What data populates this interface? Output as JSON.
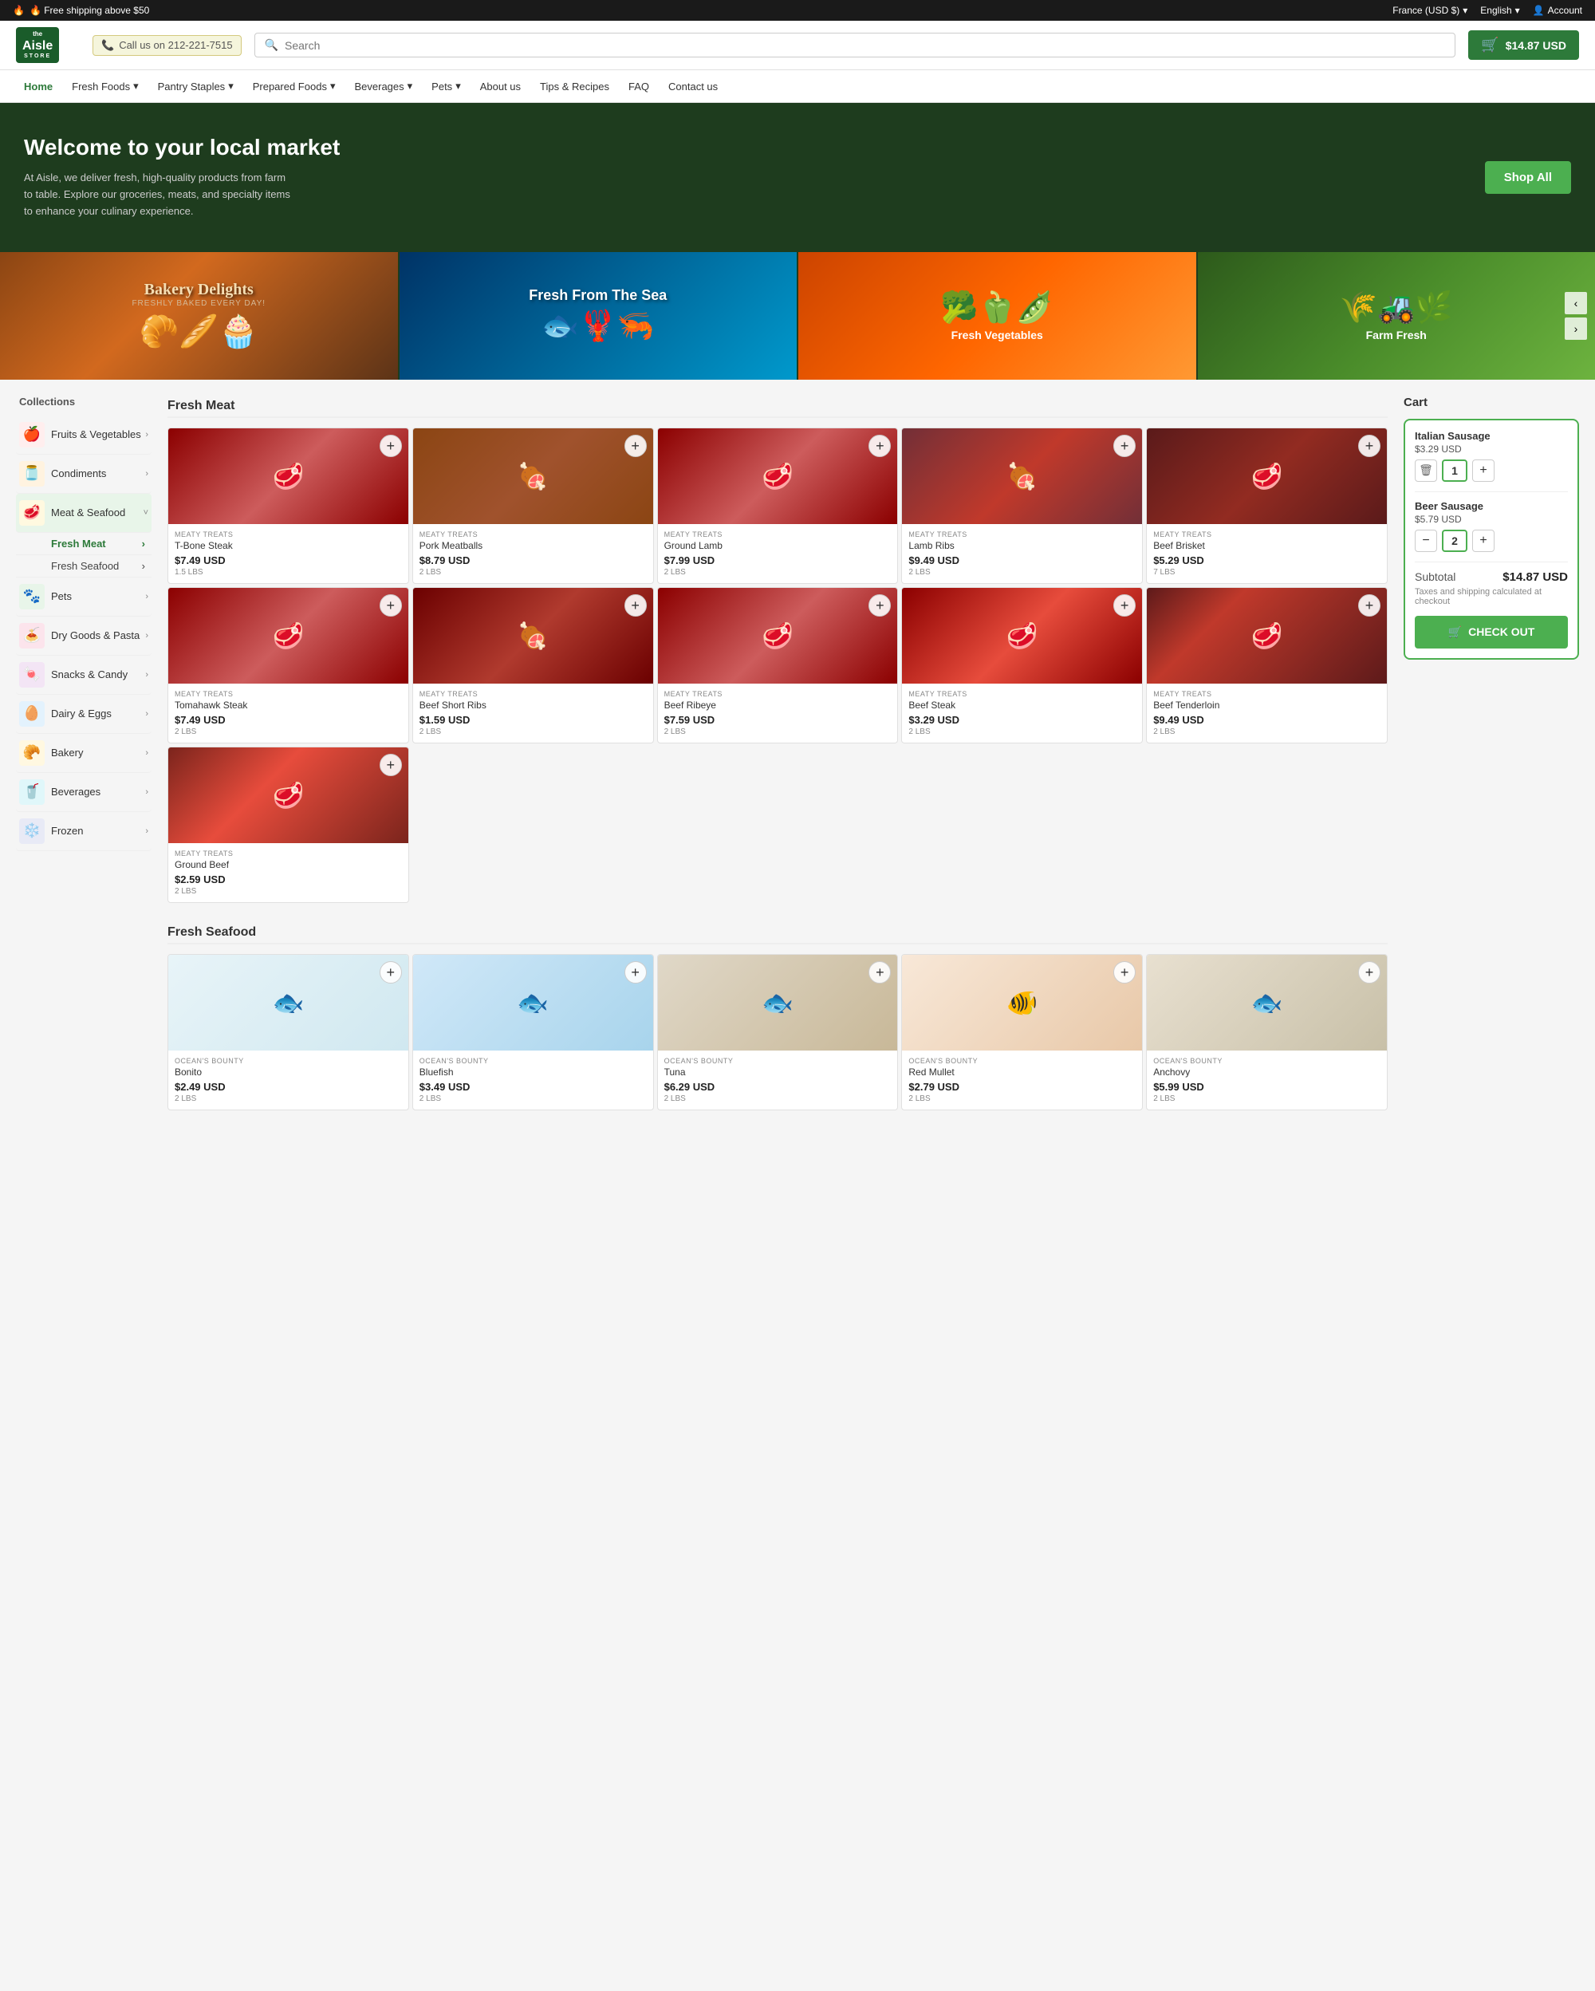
{
  "announcement": {
    "text": "🔥 Free shipping above $50",
    "currency": "France (USD $)",
    "language": "English",
    "account": "Account"
  },
  "header": {
    "logo_line1": "the",
    "logo_line2": "Aisle",
    "logo_line3": "STORE",
    "phone_label": "Call us on 212-221-7515",
    "search_placeholder": "Search",
    "cart_total": "$14.87 USD"
  },
  "nav": {
    "items": [
      {
        "label": "Home",
        "active": true
      },
      {
        "label": "Fresh Foods",
        "has_dropdown": true
      },
      {
        "label": "Pantry Staples",
        "has_dropdown": true
      },
      {
        "label": "Prepared Foods",
        "has_dropdown": true
      },
      {
        "label": "Beverages",
        "has_dropdown": true
      },
      {
        "label": "Pets",
        "has_dropdown": true
      },
      {
        "label": "About us"
      },
      {
        "label": "Tips & Recipes"
      },
      {
        "label": "FAQ"
      },
      {
        "label": "Contact us"
      }
    ]
  },
  "hero": {
    "title": "Welcome to your local market",
    "description": "At Aisle, we deliver fresh, high-quality products from farm to table. Explore our groceries, meats, and specialty items to enhance your culinary experience.",
    "shop_all_label": "Shop All"
  },
  "banners": [
    {
      "label": "Bakery Delights",
      "subtitle": "FRESHLY BAKED EVERY DAY!",
      "type": "bakery"
    },
    {
      "label": "Fresh From The Sea",
      "type": "sea"
    },
    {
      "label": "Fresh Vegetables",
      "type": "veggies"
    },
    {
      "label": "Farm Fresh",
      "type": "farm"
    }
  ],
  "sidebar": {
    "collections_label": "Collections",
    "categories": [
      {
        "icon": "🍎",
        "label": "Fruits & Vegetables",
        "bg": "#ffeeee"
      },
      {
        "icon": "🫙",
        "label": "Condiments",
        "bg": "#fff3e0"
      },
      {
        "icon": "🥩",
        "label": "Meat & Seafood",
        "bg": "#fff9e0",
        "active": true
      },
      {
        "icon": "🐾",
        "label": "Pets",
        "bg": "#e8f5e9"
      },
      {
        "icon": "🍝",
        "label": "Dry Goods & Pasta",
        "bg": "#fce4ec"
      },
      {
        "icon": "🍬",
        "label": "Snacks & Candy",
        "bg": "#f3e5f5"
      },
      {
        "icon": "🥚",
        "label": "Dairy & Eggs",
        "bg": "#e3f2fd"
      },
      {
        "icon": "🥐",
        "label": "Bakery",
        "bg": "#fff8e1"
      },
      {
        "icon": "🥤",
        "label": "Beverages",
        "bg": "#e0f7fa"
      },
      {
        "icon": "❄️",
        "label": "Frozen",
        "bg": "#e8eaf6"
      }
    ],
    "subcategories": [
      {
        "label": "Fresh Meat",
        "active": true
      },
      {
        "label": "Fresh Seafood"
      }
    ]
  },
  "fresh_meat": {
    "section_label": "Fresh Meat",
    "products": [
      {
        "brand": "Meaty Treats",
        "name": "T-Bone Steak",
        "price": "$7.49 USD",
        "weight": "1.5 LBS",
        "emoji": "🥩"
      },
      {
        "brand": "Meaty Treats",
        "name": "Pork Meatballs",
        "price": "$8.79 USD",
        "weight": "2 LBS",
        "emoji": "🍖"
      },
      {
        "brand": "Meaty Treats",
        "name": "Ground Lamb",
        "price": "$7.99 USD",
        "weight": "2 LBS",
        "emoji": "🥩"
      },
      {
        "brand": "Meaty Treats",
        "name": "Lamb Ribs",
        "price": "$9.49 USD",
        "weight": "2 LBS",
        "emoji": "🍖"
      },
      {
        "brand": "Meaty Treats",
        "name": "Beef Brisket",
        "price": "$5.29 USD",
        "weight": "7 LBS",
        "emoji": "🥩"
      },
      {
        "brand": "Meaty Treats",
        "name": "Tomahawk Steak",
        "price": "$7.49 USD",
        "weight": "2 LBS",
        "emoji": "🥩"
      },
      {
        "brand": "Meaty Treats",
        "name": "Beef Short Ribs",
        "price": "$1.59 USD",
        "weight": "2 LBS",
        "emoji": "🍖"
      },
      {
        "brand": "Meaty Treats",
        "name": "Beef Ribeye",
        "price": "$7.59 USD",
        "weight": "2 LBS",
        "emoji": "🥩"
      },
      {
        "brand": "Meaty Treats",
        "name": "Beef Steak",
        "price": "$3.29 USD",
        "weight": "2 LBS",
        "emoji": "🥩"
      },
      {
        "brand": "Meaty Treats",
        "name": "Beef Tenderloin",
        "price": "$9.49 USD",
        "weight": "2 LBS",
        "emoji": "🥩"
      },
      {
        "brand": "Meaty Treats",
        "name": "Ground Beef",
        "price": "$2.59 USD",
        "weight": "2 LBS",
        "emoji": "🥩"
      }
    ]
  },
  "fresh_seafood": {
    "section_label": "Fresh Seafood",
    "products": [
      {
        "brand": "Ocean's Bounty",
        "name": "Bonito",
        "price": "$2.49 USD",
        "weight": "2 LBS",
        "emoji": "🐟"
      },
      {
        "brand": "Ocean's Bounty",
        "name": "Bluefish",
        "price": "$3.49 USD",
        "weight": "2 LBS",
        "emoji": "🐟"
      },
      {
        "brand": "Ocean's Bounty",
        "name": "Tuna",
        "price": "$6.29 USD",
        "weight": "2 LBS",
        "emoji": "🐟"
      },
      {
        "brand": "Ocean's Bounty",
        "name": "Red Mullet",
        "price": "$2.79 USD",
        "weight": "2 LBS",
        "emoji": "🐠"
      },
      {
        "brand": "Ocean's Bounty",
        "name": "Anchovy",
        "price": "$5.99 USD",
        "weight": "2 LBS",
        "emoji": "🐟"
      }
    ]
  },
  "cart": {
    "title": "Cart",
    "items": [
      {
        "name": "Italian Sausage",
        "price": "$3.29 USD",
        "qty": 1
      },
      {
        "name": "Beer Sausage",
        "price": "$5.79 USD",
        "qty": 2
      }
    ],
    "subtotal_label": "Subtotal",
    "subtotal_amount": "$14.87 USD",
    "taxes_text": "Taxes and shipping calculated at checkout",
    "checkout_label": "CHECK OUT"
  },
  "colors": {
    "green_dark": "#1e3c1e",
    "green_brand": "#2d7a3a",
    "green_light": "#4CAF50",
    "accent": "#4CAF50"
  }
}
